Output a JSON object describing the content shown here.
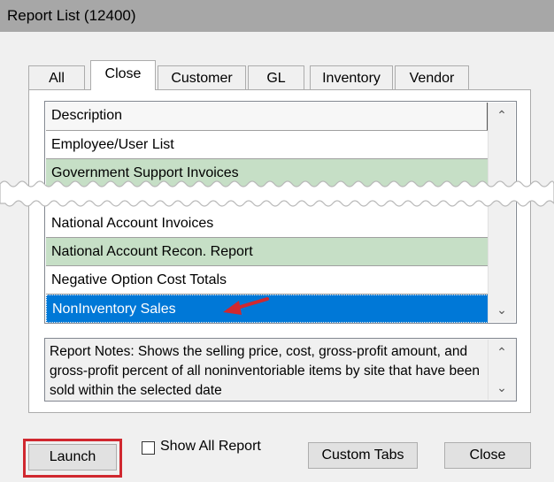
{
  "window": {
    "title": "Report List (12400)"
  },
  "tabs": [
    {
      "label": "All"
    },
    {
      "label": "Close",
      "active": true
    },
    {
      "label": "Customer"
    },
    {
      "label": "GL"
    },
    {
      "label": "Inventory"
    },
    {
      "label": "Vendor"
    }
  ],
  "grid": {
    "header": "Description",
    "rows_top": [
      {
        "label": "Employee/User List",
        "color": "white"
      },
      {
        "label": "Government Support Invoices",
        "color": "green"
      }
    ],
    "rows_bottom": [
      {
        "label": "National Account Invoices",
        "color": "white"
      },
      {
        "label": "National Account Recon. Report",
        "color": "green"
      },
      {
        "label": "Negative Option Cost Totals",
        "color": "white"
      },
      {
        "label": "NonInventory Sales",
        "color": "selected"
      }
    ]
  },
  "notes": {
    "text": "Report Notes:  Shows the selling price, cost, gross-profit amount, and gross-profit percent of all noninventoriable items by site that have been sold within the selected date"
  },
  "buttons": {
    "launch": "Launch",
    "show_all": "Show All Report",
    "custom_tabs": "Custom Tabs",
    "close": "Close"
  },
  "colors": {
    "selected_row": "#0078d7",
    "green_row": "#c6dfc6",
    "highlight": "#d0282f",
    "annotation_arrow": "#d0282f"
  },
  "icons": {
    "scroll_up": "chevron-up-icon",
    "scroll_down": "chevron-down-icon"
  }
}
